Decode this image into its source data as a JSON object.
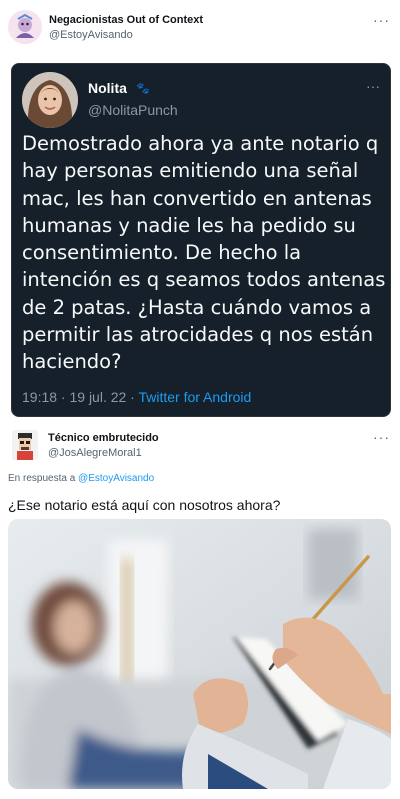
{
  "original_tweet": {
    "author_name": "Negacionistas Out of Context",
    "author_handle": "@EstoyAvisando",
    "more_label": "···"
  },
  "quoted_tweet": {
    "author_name": "Nolita",
    "flag_icon": "🐾",
    "author_handle": "@NolitaPunch",
    "more_label": "···",
    "text": "Demostrado ahora ya ante notario q hay personas emitiendo una señal mac, les han convertido en antenas humanas y nadie les ha pedido su consentimiento. De hecho la intención es q seamos todos antenas de 2 patas. ¿Hasta cuándo vamos a permitir las atrocidades q nos están haciendo?",
    "timestamp": "19:18 · 19 jul. 22 · ",
    "source": "Twitter for Android"
  },
  "reply_tweet": {
    "author_name": "Técnico embrutecido",
    "author_handle": "@JosAlegreMoral1",
    "more_label": "···",
    "in_reply_prefix": "En respuesta a ",
    "in_reply_handle": "@EstoyAvisando",
    "text": "¿Ese notario está aquí con nosotros ahora?"
  },
  "colors": {
    "card_bg": "#15202b",
    "link_blue": "#1d9bf0",
    "secondary_text": "#536471"
  }
}
